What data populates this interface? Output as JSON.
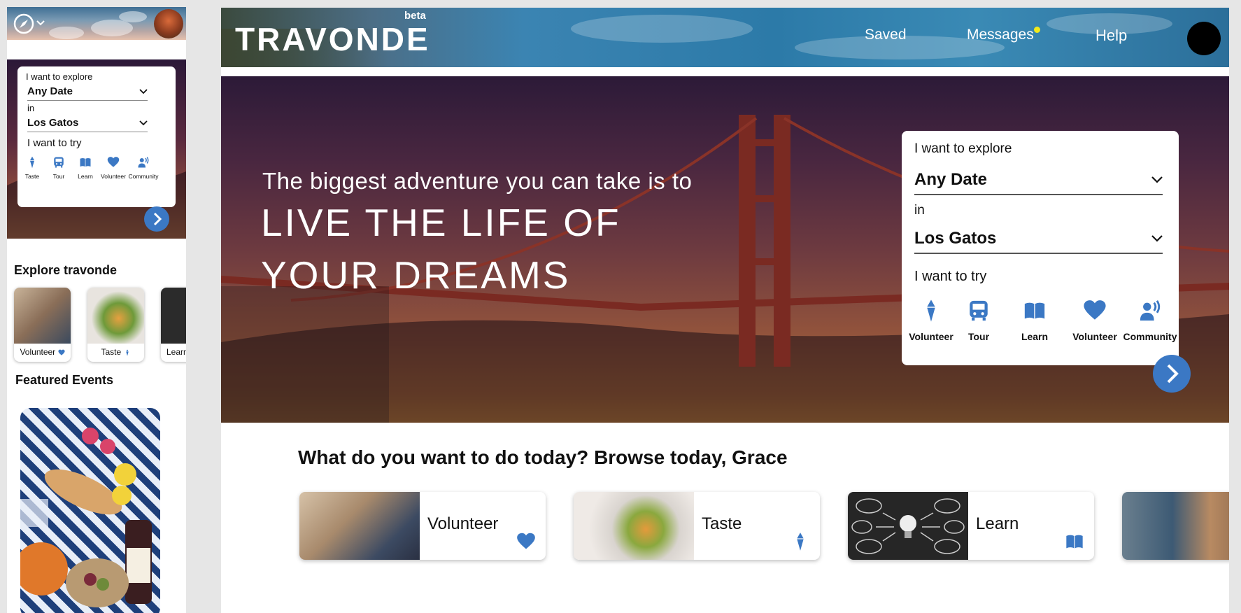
{
  "colors": {
    "accent": "#3b78c4",
    "notification_dot": "#f2ea1a",
    "white": "#ffffff"
  },
  "mobile": {
    "header": {
      "compass_icon": "compass-icon",
      "menu_icon": "chevron-down-icon",
      "avatar": "user-avatar"
    },
    "search": {
      "explore_label": "I want to explore",
      "date_value": "Any Date",
      "in_label": "in",
      "location_value": "Los Gatos",
      "try_label": "I want to try",
      "categories": [
        {
          "label": "Taste",
          "icon": "ice-cream-icon"
        },
        {
          "label": "Tour",
          "icon": "bus-icon"
        },
        {
          "label": "Learn",
          "icon": "book-icon"
        },
        {
          "label": "Volunteer",
          "icon": "heart-icon"
        },
        {
          "label": "Community",
          "icon": "community-icon"
        }
      ],
      "go_icon": "chevron-right-icon"
    },
    "explore": {
      "title": "Explore travonde",
      "tiles": [
        {
          "label": "Volunteer",
          "icon": "heart-icon"
        },
        {
          "label": "Taste",
          "icon": "ice-cream-icon"
        },
        {
          "label": "Learn",
          "icon": "book-icon"
        }
      ]
    },
    "featured": {
      "title": "Featured Events"
    }
  },
  "desktop": {
    "header": {
      "logo": "TRAVONDE",
      "beta": "beta",
      "nav": [
        "Saved",
        "Messages",
        "Help"
      ],
      "avatar": "user-avatar"
    },
    "hero": {
      "tagline": "The biggest adventure you can take is to",
      "headline_line1": "LIVE THE LIFE OF",
      "headline_line2": "YOUR DREAMS"
    },
    "search": {
      "explore_label": "I want to explore",
      "date_value": "Any Date",
      "in_label": "in",
      "location_value": "Los Gatos",
      "try_label": "I want to try",
      "categories": [
        {
          "label": "Volunteer",
          "icon": "ice-cream-icon"
        },
        {
          "label": "Tour",
          "icon": "bus-icon"
        },
        {
          "label": "Learn",
          "icon": "book-icon"
        },
        {
          "label": "Volunteer",
          "icon": "heart-icon"
        },
        {
          "label": "Community",
          "icon": "community-icon"
        }
      ],
      "go_icon": "chevron-right-icon"
    },
    "browse": {
      "title": "What do you want to do today? Browse today, Grace",
      "tiles": [
        {
          "label": "Volunteer",
          "icon": "heart-icon"
        },
        {
          "label": "Taste",
          "icon": "ice-cream-icon"
        },
        {
          "label": "Learn",
          "icon": "book-icon"
        }
      ]
    }
  }
}
